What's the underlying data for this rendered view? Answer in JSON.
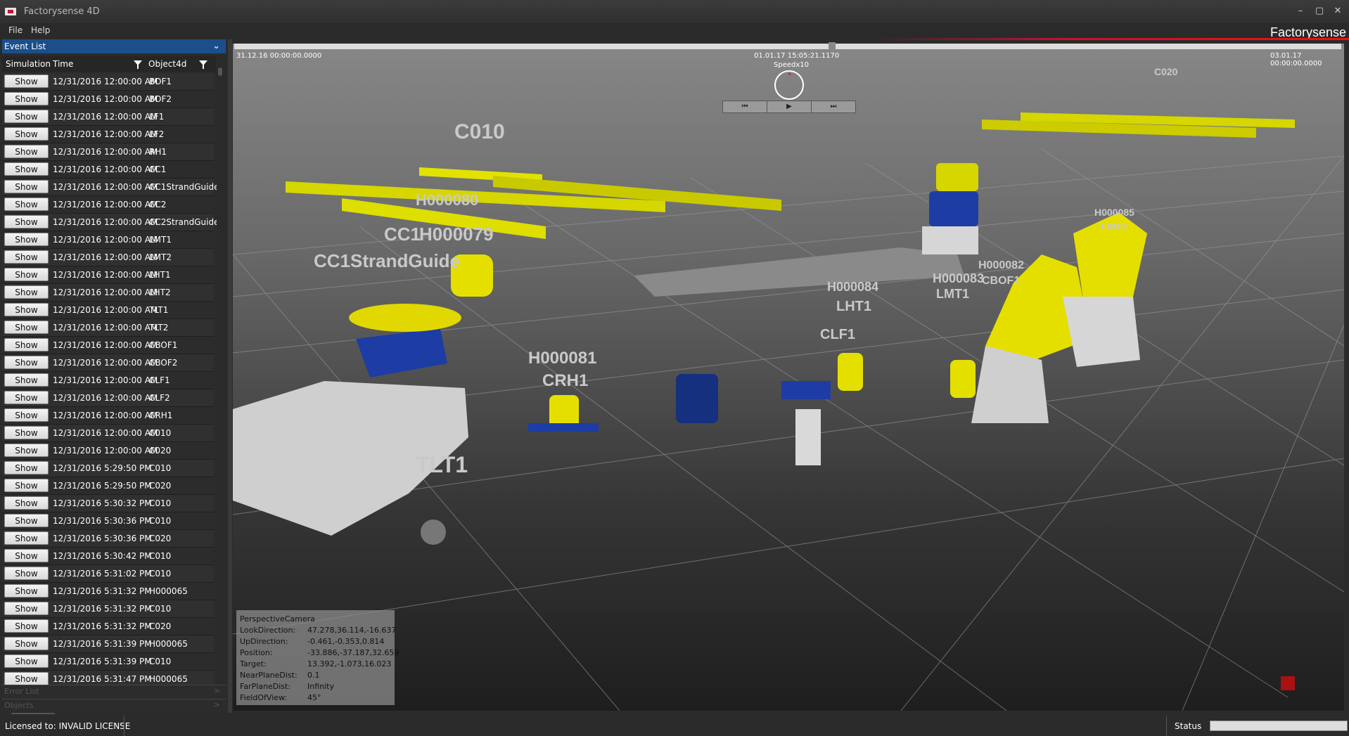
{
  "window": {
    "title": "Factorysense 4D",
    "minimize": "–",
    "maximize": "▢",
    "close": "✕"
  },
  "menu": {
    "file": "File",
    "help": "Help",
    "brand": "Factorysense"
  },
  "event_list": {
    "title": "Event List",
    "columns": {
      "simulation": "Simulation",
      "time": "Time",
      "object": "Object4d"
    },
    "show_label": "Show",
    "rows": [
      {
        "time": "12/31/2016 12:00:00 AM",
        "object": "BOF1"
      },
      {
        "time": "12/31/2016 12:00:00 AM",
        "object": "BOF2"
      },
      {
        "time": "12/31/2016 12:00:00 AM",
        "object": "LF1"
      },
      {
        "time": "12/31/2016 12:00:00 AM",
        "object": "LF2"
      },
      {
        "time": "12/31/2016 12:00:00 AM",
        "object": "RH1"
      },
      {
        "time": "12/31/2016 12:00:00 AM",
        "object": "CC1"
      },
      {
        "time": "12/31/2016 12:00:00 AM",
        "object": "CC1StrandGuide"
      },
      {
        "time": "12/31/2016 12:00:00 AM",
        "object": "CC2"
      },
      {
        "time": "12/31/2016 12:00:00 AM",
        "object": "CC2StrandGuide"
      },
      {
        "time": "12/31/2016 12:00:00 AM",
        "object": "LMT1"
      },
      {
        "time": "12/31/2016 12:00:00 AM",
        "object": "LMT2"
      },
      {
        "time": "12/31/2016 12:00:00 AM",
        "object": "LHT1"
      },
      {
        "time": "12/31/2016 12:00:00 AM",
        "object": "LHT2"
      },
      {
        "time": "12/31/2016 12:00:00 AM",
        "object": "TLT1"
      },
      {
        "time": "12/31/2016 12:00:00 AM",
        "object": "TLT2"
      },
      {
        "time": "12/31/2016 12:00:00 AM",
        "object": "CBOF1"
      },
      {
        "time": "12/31/2016 12:00:00 AM",
        "object": "CBOF2"
      },
      {
        "time": "12/31/2016 12:00:00 AM",
        "object": "CLF1"
      },
      {
        "time": "12/31/2016 12:00:00 AM",
        "object": "CLF2"
      },
      {
        "time": "12/31/2016 12:00:00 AM",
        "object": "CRH1"
      },
      {
        "time": "12/31/2016 12:00:00 AM",
        "object": "C010"
      },
      {
        "time": "12/31/2016 12:00:00 AM",
        "object": "C020"
      },
      {
        "time": "12/31/2016 5:29:50 PM",
        "object": "C010"
      },
      {
        "time": "12/31/2016 5:29:50 PM",
        "object": "C020"
      },
      {
        "time": "12/31/2016 5:30:32 PM",
        "object": "C010"
      },
      {
        "time": "12/31/2016 5:30:36 PM",
        "object": "C010"
      },
      {
        "time": "12/31/2016 5:30:36 PM",
        "object": "C020"
      },
      {
        "time": "12/31/2016 5:30:42 PM",
        "object": "C010"
      },
      {
        "time": "12/31/2016 5:31:02 PM",
        "object": "C010"
      },
      {
        "time": "12/31/2016 5:31:32 PM",
        "object": "H000065"
      },
      {
        "time": "12/31/2016 5:31:32 PM",
        "object": "C010"
      },
      {
        "time": "12/31/2016 5:31:32 PM",
        "object": "C020"
      },
      {
        "time": "12/31/2016 5:31:39 PM",
        "object": "H000065"
      },
      {
        "time": "12/31/2016 5:31:39 PM",
        "object": "C010"
      },
      {
        "time": "12/31/2016 5:31:47 PM",
        "object": "H000065"
      }
    ]
  },
  "error_list": {
    "title": "Error List"
  },
  "objects_panel": {
    "title": "Objects"
  },
  "timeline": {
    "start": "31.12.16 00:00:00.0000",
    "current": "01.01.17 15:05:21.1170",
    "end": "03.01.17 00:00:00.0000",
    "speed": "Speedx10",
    "progress": 0.54
  },
  "playback": {
    "prev": "⏮",
    "play": "▶",
    "next": "⏭"
  },
  "scene_labels": {
    "c010": "C010",
    "h000080": "H000080",
    "cc1": "CC1",
    "h000079": "H000079",
    "cc1strandguide": "CC1StrandGuide",
    "h000081": "H000081",
    "crh1": "CRH1",
    "tlt1": "TLT1",
    "clf1": "CLF1",
    "h000084": "H000084",
    "lht1": "LHT1",
    "h000083": "H000083",
    "lmt1": "LMT1",
    "h000082": "H000082",
    "cbof1": "CBOF1",
    "h000085": "H000085",
    "lmt2": "LMT2",
    "c020": "C020"
  },
  "camera": {
    "title": "PerspectiveCamera",
    "rows": [
      {
        "label": "LookDirection:",
        "value": "47.278,36.114,-16.637"
      },
      {
        "label": "UpDirection:",
        "value": "-0.461,-0.353,0.814"
      },
      {
        "label": "Position:",
        "value": "-33.886,-37.187,32.659"
      },
      {
        "label": "Target:",
        "value": "13.392,-1.073,16.023"
      },
      {
        "label": "NearPlaneDist:",
        "value": "0.1"
      },
      {
        "label": "FarPlaneDist:",
        "value": "Infinity"
      },
      {
        "label": "FieldOfView:",
        "value": "45°"
      }
    ]
  },
  "status": {
    "license": "Licensed to: INVALID LICENSE",
    "label": "Status"
  },
  "colors": {
    "accent": "#1b4f8a",
    "brand_red": "#c8102e",
    "yellow": "#e8e800",
    "blue": "#1a3a9a"
  }
}
